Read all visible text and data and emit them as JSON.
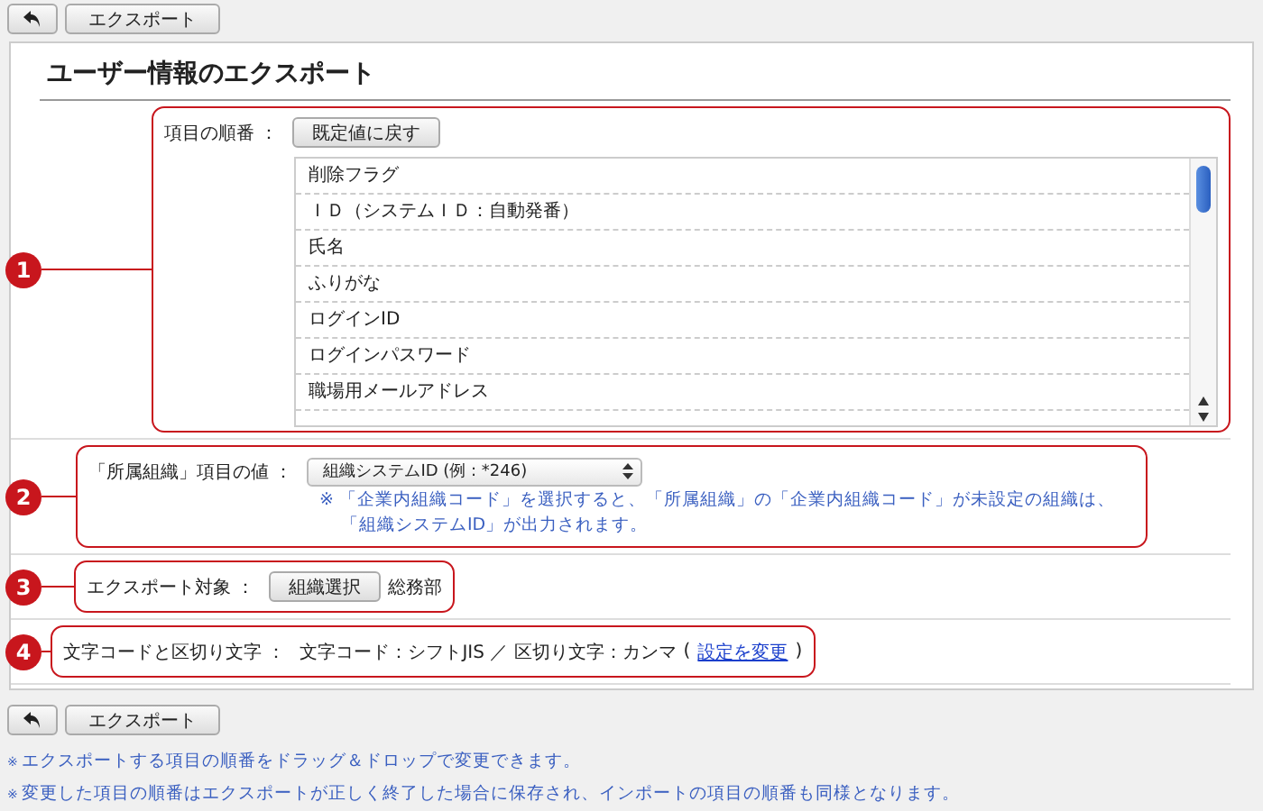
{
  "top_toolbar": {
    "export_button": "エクスポート"
  },
  "title": "ユーザー情報のエクスポート",
  "sections": [
    {
      "number": "1",
      "kind": "order",
      "label": "項目の順番 ：",
      "reset_button": "既定値に戻す",
      "items": [
        "削除フラグ",
        "ＩＤ（システムＩＤ：自動発番）",
        "氏名",
        "ふりがな",
        "ログインID",
        "ログインパスワード",
        "職場用メールアドレス"
      ]
    },
    {
      "number": "2",
      "kind": "select",
      "label": "「所属組織」項目の値 ：",
      "value": "組織システムID (例 : *246)",
      "notes": [
        "※ 「企業内組織コード」を選択すると、「所属組織」の「企業内組織コード」が未設定の組織は、",
        "「組織システムID」が出力されます。"
      ]
    },
    {
      "number": "3",
      "kind": "target",
      "label": "エクスポート対象 ：",
      "button": "組織選択",
      "value": "総務部"
    },
    {
      "number": "4",
      "kind": "encoding",
      "label": "文字コードと区切り文字 ：",
      "value": "文字コード：シフトJIS ／ 区切り文字：カンマ",
      "link_open": "(",
      "link": "設定を変更",
      "link_close": ")"
    }
  ],
  "bottom_toolbar": {
    "export_button": "エクスポート"
  },
  "notes": [
    {
      "mark": "※",
      "text": "エクスポートする項目の順番をドラッグ＆ドロップで変更できます。"
    },
    {
      "mark": "※",
      "text": "変更した項目の順番はエクスポートが正しく終了した場合に保存され、インポートの項目の順番も同様となります。"
    }
  ]
}
